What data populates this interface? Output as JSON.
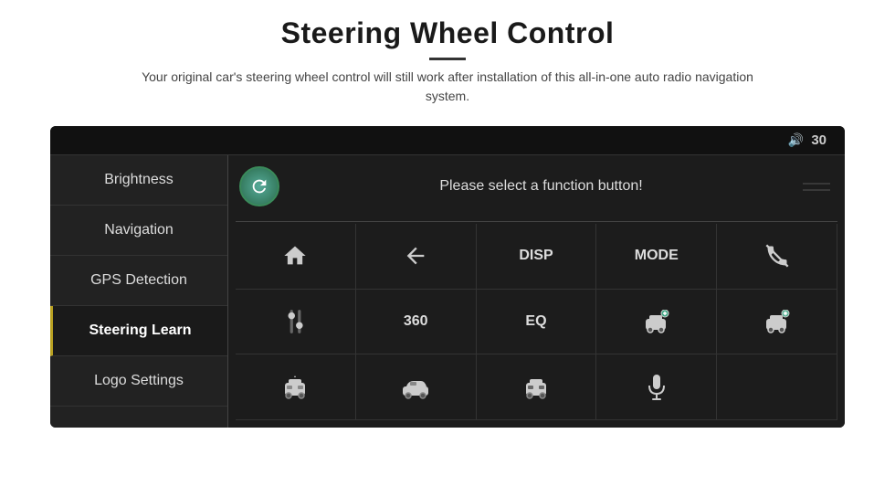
{
  "header": {
    "title": "Steering Wheel Control",
    "subtitle": "Your original car's steering wheel control will still work after installation of this all-in-one auto radio navigation system."
  },
  "device": {
    "volume_label": "30",
    "function_prompt": "Please select a function button!",
    "sidebar_items": [
      {
        "id": "brightness",
        "label": "Brightness",
        "active": false
      },
      {
        "id": "navigation",
        "label": "Navigation",
        "active": false
      },
      {
        "id": "gps-detection",
        "label": "GPS Detection",
        "active": false
      },
      {
        "id": "steering-learn",
        "label": "Steering Learn",
        "active": true
      },
      {
        "id": "logo-settings",
        "label": "Logo Settings",
        "active": false
      }
    ],
    "grid_buttons": [
      {
        "id": "home",
        "type": "icon",
        "icon": "home"
      },
      {
        "id": "back",
        "type": "icon",
        "icon": "back"
      },
      {
        "id": "disp",
        "type": "text",
        "label": "DISP"
      },
      {
        "id": "mode",
        "type": "text",
        "label": "MODE"
      },
      {
        "id": "phone-mute",
        "type": "icon",
        "icon": "phone-mute"
      },
      {
        "id": "tune",
        "type": "icon",
        "icon": "tune"
      },
      {
        "id": "360",
        "type": "text",
        "label": "360"
      },
      {
        "id": "eq",
        "type": "text",
        "label": "EQ"
      },
      {
        "id": "camera1",
        "type": "icon",
        "icon": "camera"
      },
      {
        "id": "camera2",
        "type": "icon",
        "icon": "camera-flip"
      },
      {
        "id": "car-front",
        "type": "icon",
        "icon": "car-front"
      },
      {
        "id": "car-side",
        "type": "icon",
        "icon": "car-side"
      },
      {
        "id": "car-rear",
        "type": "icon",
        "icon": "car-rear"
      },
      {
        "id": "mic",
        "type": "icon",
        "icon": "microphone"
      },
      {
        "id": "empty",
        "type": "empty",
        "label": ""
      }
    ]
  }
}
